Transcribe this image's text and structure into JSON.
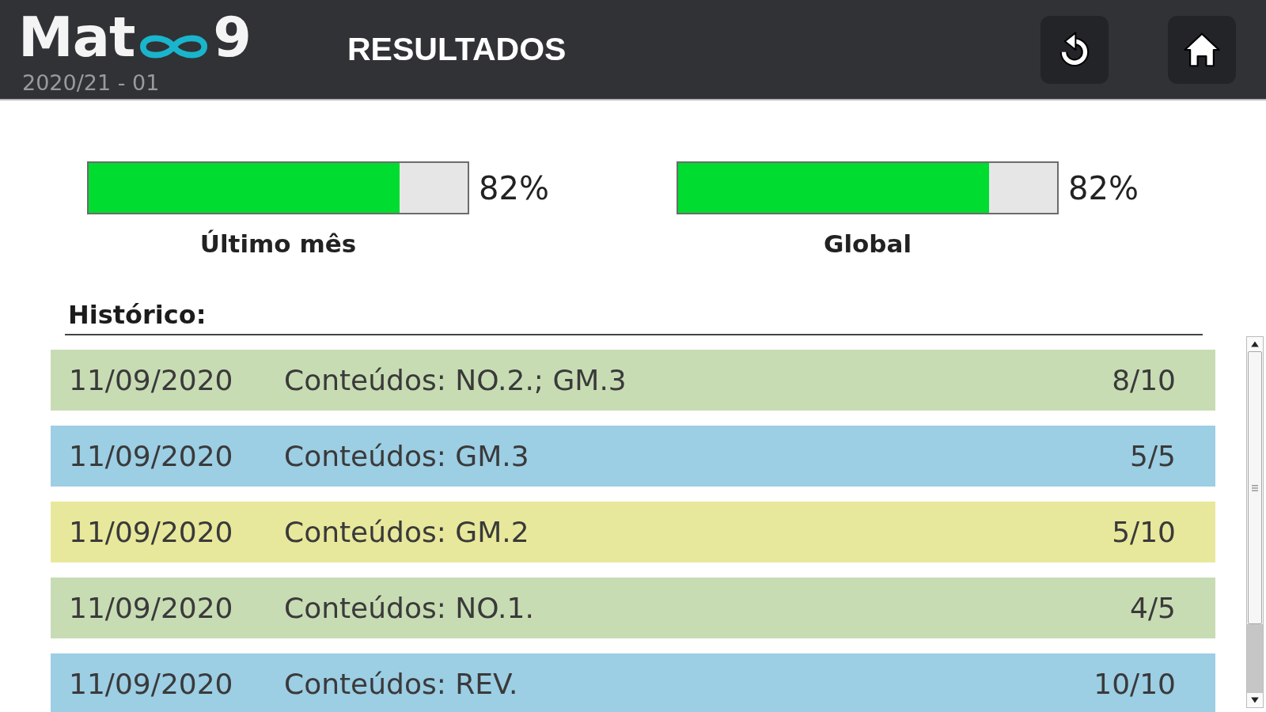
{
  "header": {
    "logo": {
      "prefix": "Mat",
      "suffix": "9"
    },
    "session": "2020/21 - 01",
    "title": "RESULTADOS",
    "buttons": [
      {
        "kind": "refresh"
      },
      {
        "kind": "home"
      }
    ]
  },
  "progress": [
    {
      "label": "Último mês",
      "level": 0.82,
      "reading": "82%"
    },
    {
      "label": "Global",
      "level": 0.82,
      "reading": "82%"
    }
  ],
  "history": {
    "title": "Histórico:",
    "rows": [
      {
        "date": "11/09/2020",
        "content": "Conteúdos: NO.2.; GM.3",
        "score": "8/10",
        "color": "#c8dcb4"
      },
      {
        "date": "11/09/2020",
        "content": "Conteúdos: GM.3",
        "score": "5/5",
        "color": "#9ccee4"
      },
      {
        "date": "11/09/2020",
        "content": "Conteúdos: GM.2",
        "score": "5/10",
        "color": "#e8e89c"
      },
      {
        "date": "11/09/2020",
        "content": "Conteúdos: NO.1.",
        "score": "4/5",
        "color": "#c8dcb4"
      },
      {
        "date": "11/09/2020",
        "content": "Conteúdos: REV.",
        "score": "10/10",
        "color": "#9ccee4"
      }
    ]
  }
}
